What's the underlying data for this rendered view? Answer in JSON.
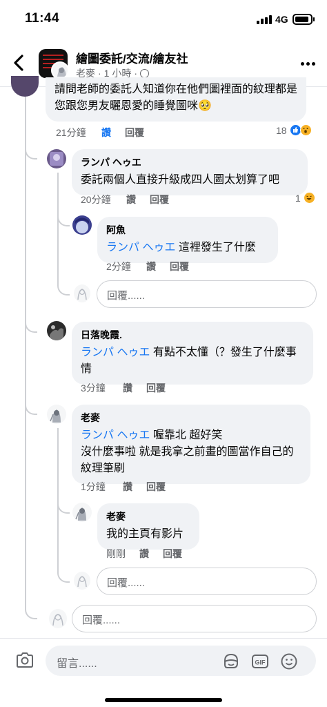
{
  "status_bar": {
    "time": "11:44",
    "network": "4G"
  },
  "header": {
    "group_name": "繪圖委託/交流/繪友社",
    "author": "老麥",
    "time_ago": "1 小時"
  },
  "actions_labels": {
    "like": "讚",
    "reply": "回覆"
  },
  "comments": [
    {
      "text": "請問老師的委託人知道你在他們圖裡面的紋理都是您跟您男友曬恩愛的睡覺圖咪🥺",
      "time": "21分鐘",
      "liked": true,
      "reaction_count": "18"
    },
    {
      "name": "ランパ ヘゥエ",
      "text": "委託兩個人直接升級成四人圖太划算了吧",
      "time": "20分鐘",
      "reaction_count": "1"
    },
    {
      "name": "阿魚",
      "mention": "ランパ ヘゥエ",
      "text": "這裡發生了什麼",
      "time": "2分鐘"
    },
    {
      "name": "日落晚霞.",
      "mention": "ランパ ヘゥエ",
      "text": "有點不太懂（？發生了什麼事情",
      "time": "3分鐘"
    },
    {
      "name": "老麥",
      "mention": "ランパ ヘゥエ",
      "text_line1": "喔靠北 超好笑",
      "text_line2": "沒什麼事啦 就是我拿之前畫的圖當作自己的紋理筆刷",
      "time": "1分鐘"
    },
    {
      "name": "老麥",
      "text": "我的主頁有影片",
      "time": "剛剛"
    }
  ],
  "reply_placeholder": "回覆......",
  "composer": {
    "placeholder": "留言......",
    "gif_label": "GIF"
  },
  "colors": {
    "accent": "#1877f2",
    "bubble": "#f0f2f5",
    "secondary_text": "#65676b"
  }
}
